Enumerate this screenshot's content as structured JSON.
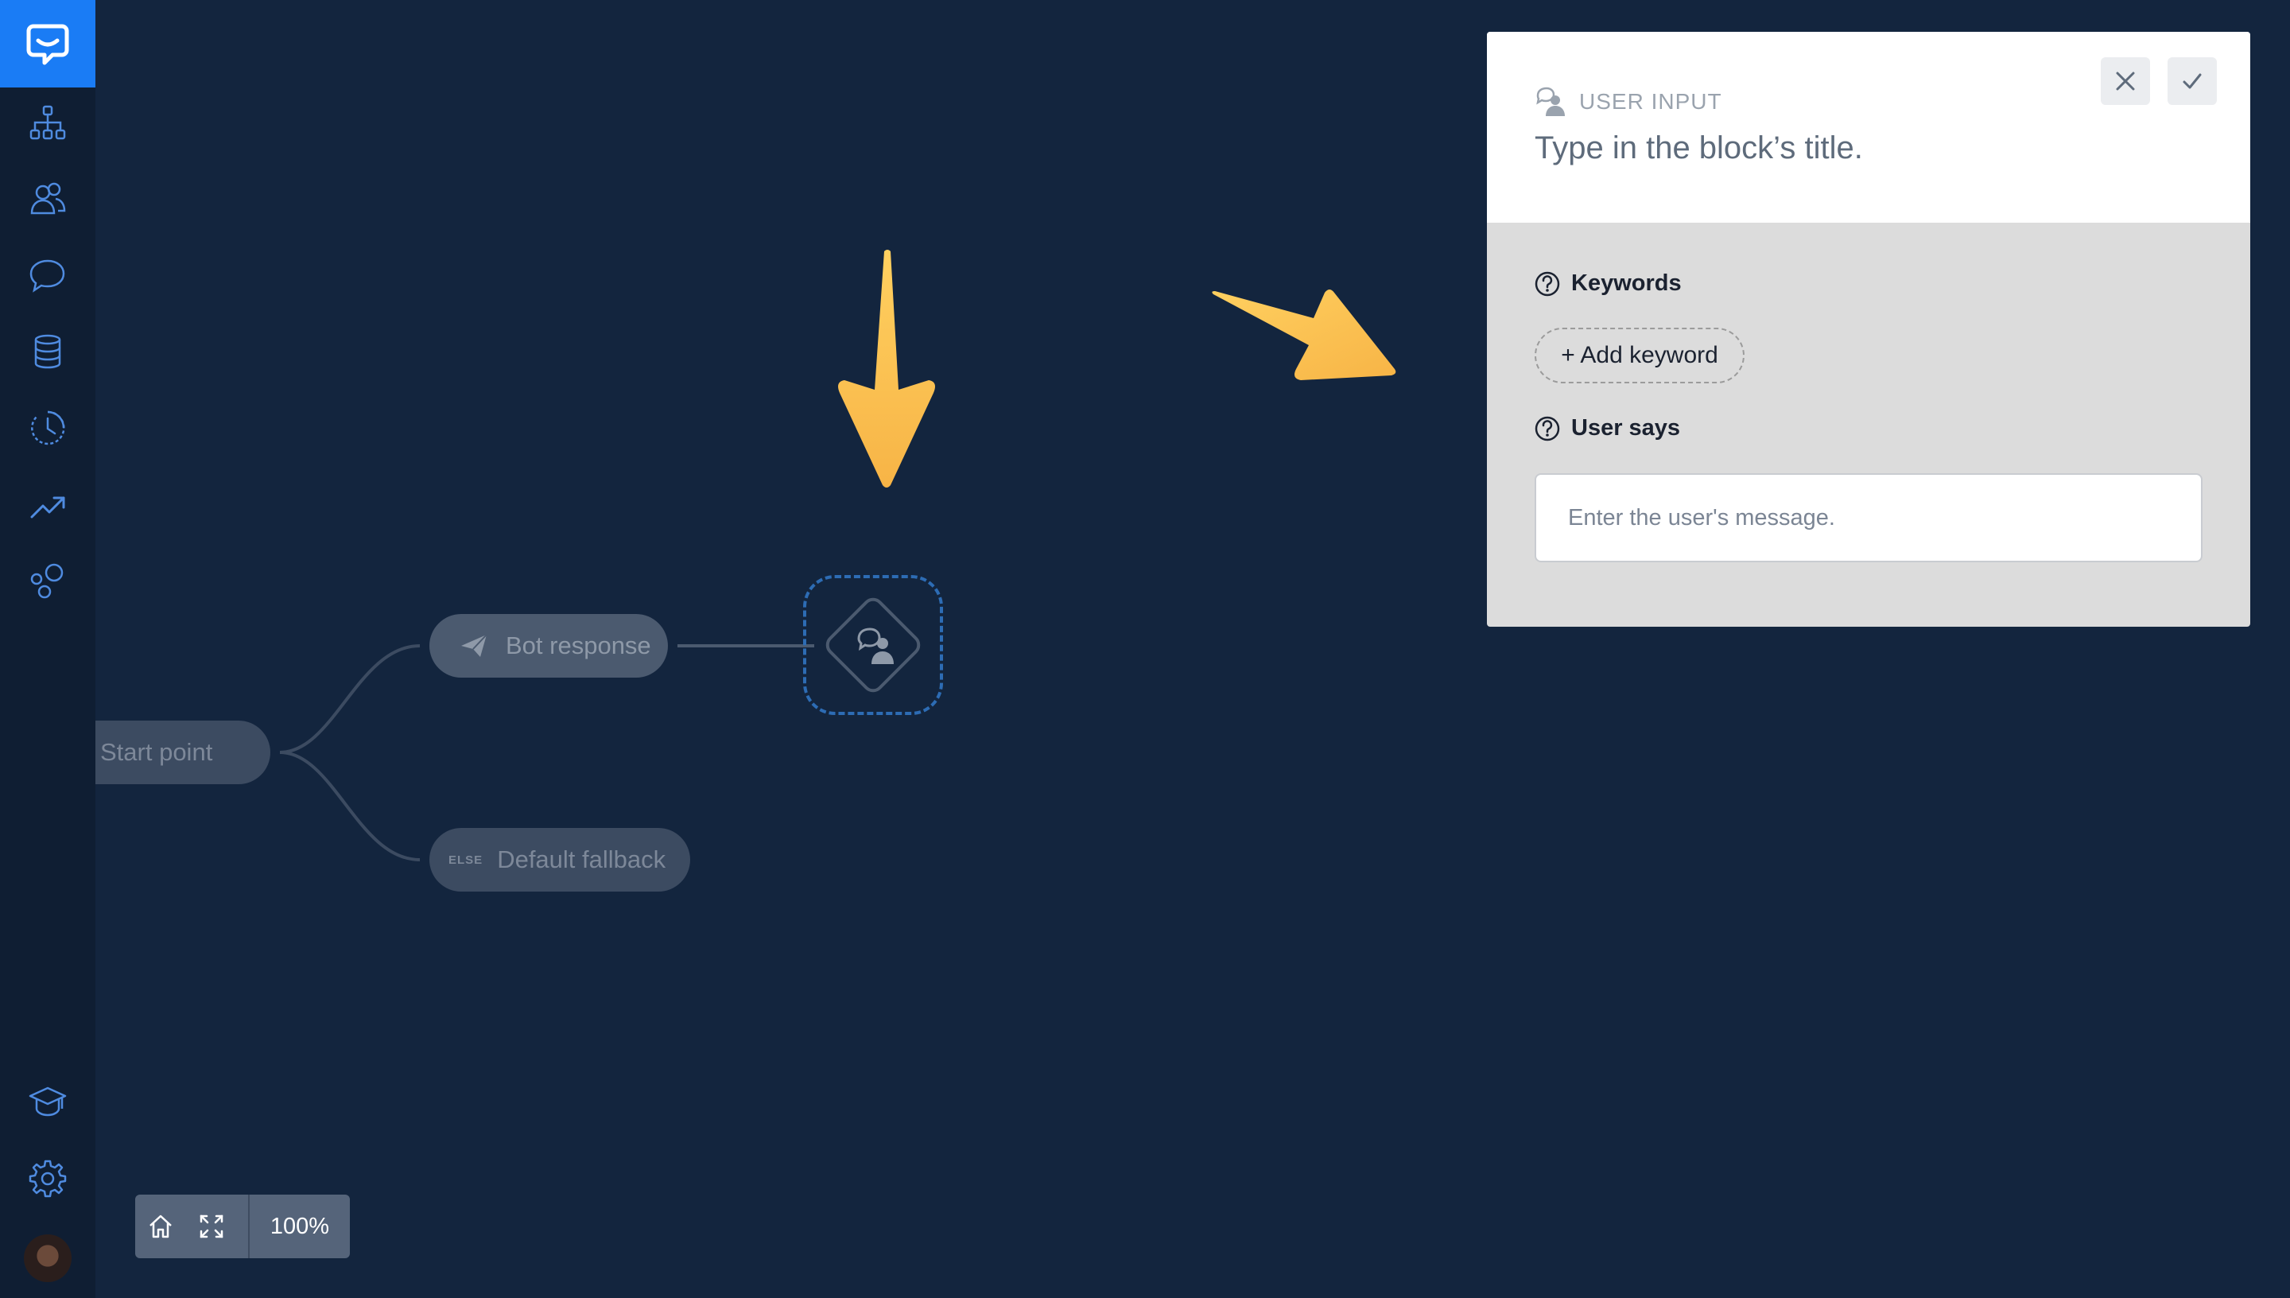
{
  "canvas": {
    "start_point_label": "Start point",
    "bot_response_label": "Bot response",
    "fallback_tag": "ELSE",
    "fallback_label": "Default fallback"
  },
  "zoom": {
    "level_label": "100%"
  },
  "panel": {
    "block_type_label": "USER INPUT",
    "title_placeholder": "Type in the block’s title.",
    "keywords_label": "Keywords",
    "add_keyword_label": "+ Add keyword",
    "user_says_label": "User says",
    "message_placeholder": "Enter the user's message."
  },
  "colors": {
    "background": "#13253e",
    "sidebar": "#0f1e33",
    "brand": "#1a7cf5",
    "arrow": "#fbbf4e"
  }
}
